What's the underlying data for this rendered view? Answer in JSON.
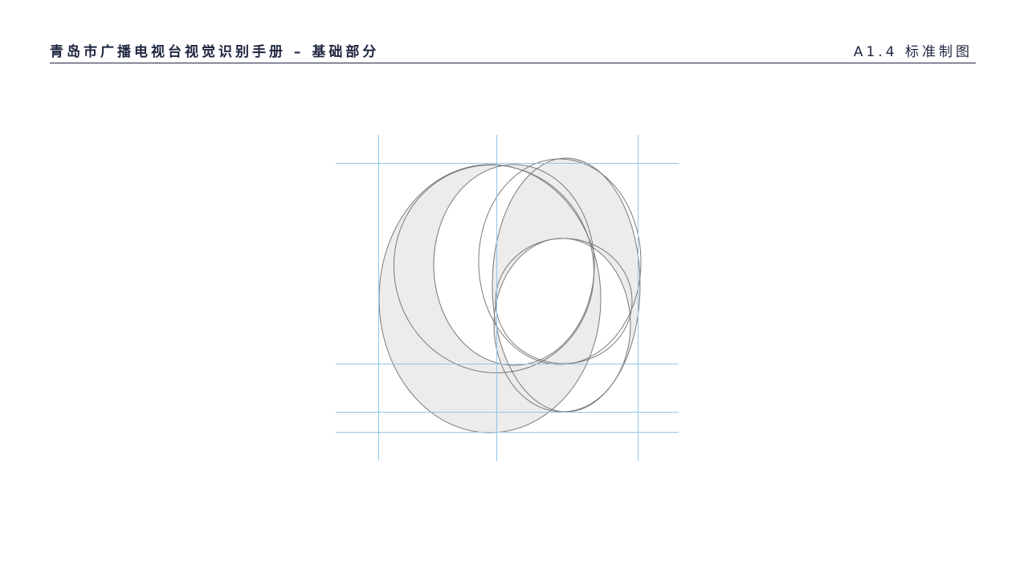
{
  "header": {
    "title": "青岛市广播电视台视觉识别手册 – 基础部分",
    "section": "A1.4 标准制图"
  },
  "colors": {
    "header_text": "#1f2540",
    "guide_line": "#8fc6ea",
    "outline": "#7a7a7a",
    "fill": "#ececec"
  }
}
